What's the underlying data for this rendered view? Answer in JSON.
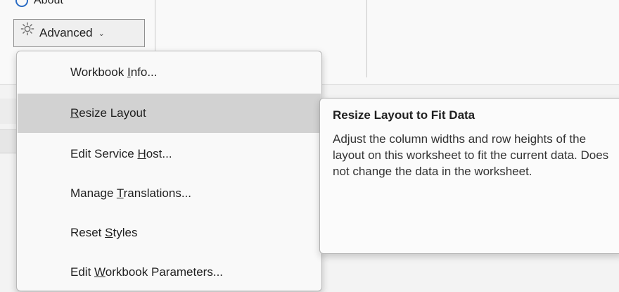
{
  "about": {
    "label": "About"
  },
  "advanced_button": {
    "label": "Advanced",
    "chevron": "⌄",
    "icon": "gear-icon"
  },
  "menu": {
    "items": [
      {
        "pre": "Workbook ",
        "key": "I",
        "post": "nfo..."
      },
      {
        "pre": "",
        "key": "R",
        "post": "esize Layout"
      },
      {
        "pre": "Edit Service ",
        "key": "H",
        "post": "ost..."
      },
      {
        "pre": "Manage ",
        "key": "T",
        "post": "ranslations..."
      },
      {
        "pre": "Reset ",
        "key": "S",
        "post": "tyles"
      },
      {
        "pre": "Edit ",
        "key": "W",
        "post": "orkbook Parameters..."
      }
    ],
    "highlighted_index": 1
  },
  "tooltip": {
    "title": "Resize Layout to Fit Data",
    "body": "Adjust the column widths and row heights of the layout on this worksheet to fit the current data. Does not change the data in the worksheet."
  },
  "colors": {
    "highlight": "#d2d2d2",
    "menu_bg": "#f9f9f9",
    "about_icon": "#2b6cc4"
  }
}
